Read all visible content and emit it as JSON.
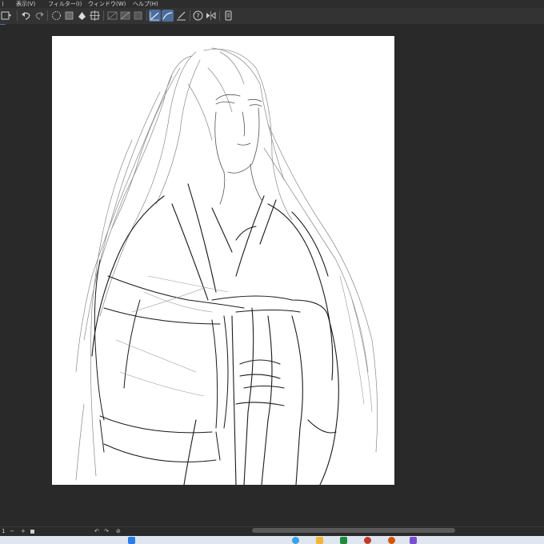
{
  "menu": [
    {
      "label": ")"
    },
    {
      "label": "表示(V)"
    },
    {
      "label": "フィルター(I)"
    },
    {
      "label": "ウィンドウ(W)"
    },
    {
      "label": "ヘルプ(H)"
    }
  ],
  "toolbar": {
    "icons": [
      "new-file-icon",
      "undo-icon",
      "redo-icon",
      "clear-icon",
      "fill-icon",
      "select-icon",
      "transform-icon",
      "ruler-icon",
      "layer-select-icon",
      "snap-line-icon",
      "snap-curve-icon",
      "snap-grid-icon",
      "help-icon",
      "flip-icon",
      "device-icon"
    ],
    "active": [
      "snap-line-icon",
      "snap-curve-icon"
    ]
  },
  "status": {
    "zoom": "1",
    "minus": "−",
    "plus": "+"
  },
  "colors": {
    "accent": "#4a6e9e",
    "panel": "#2b2b2b",
    "canvas": "#ffffff"
  }
}
